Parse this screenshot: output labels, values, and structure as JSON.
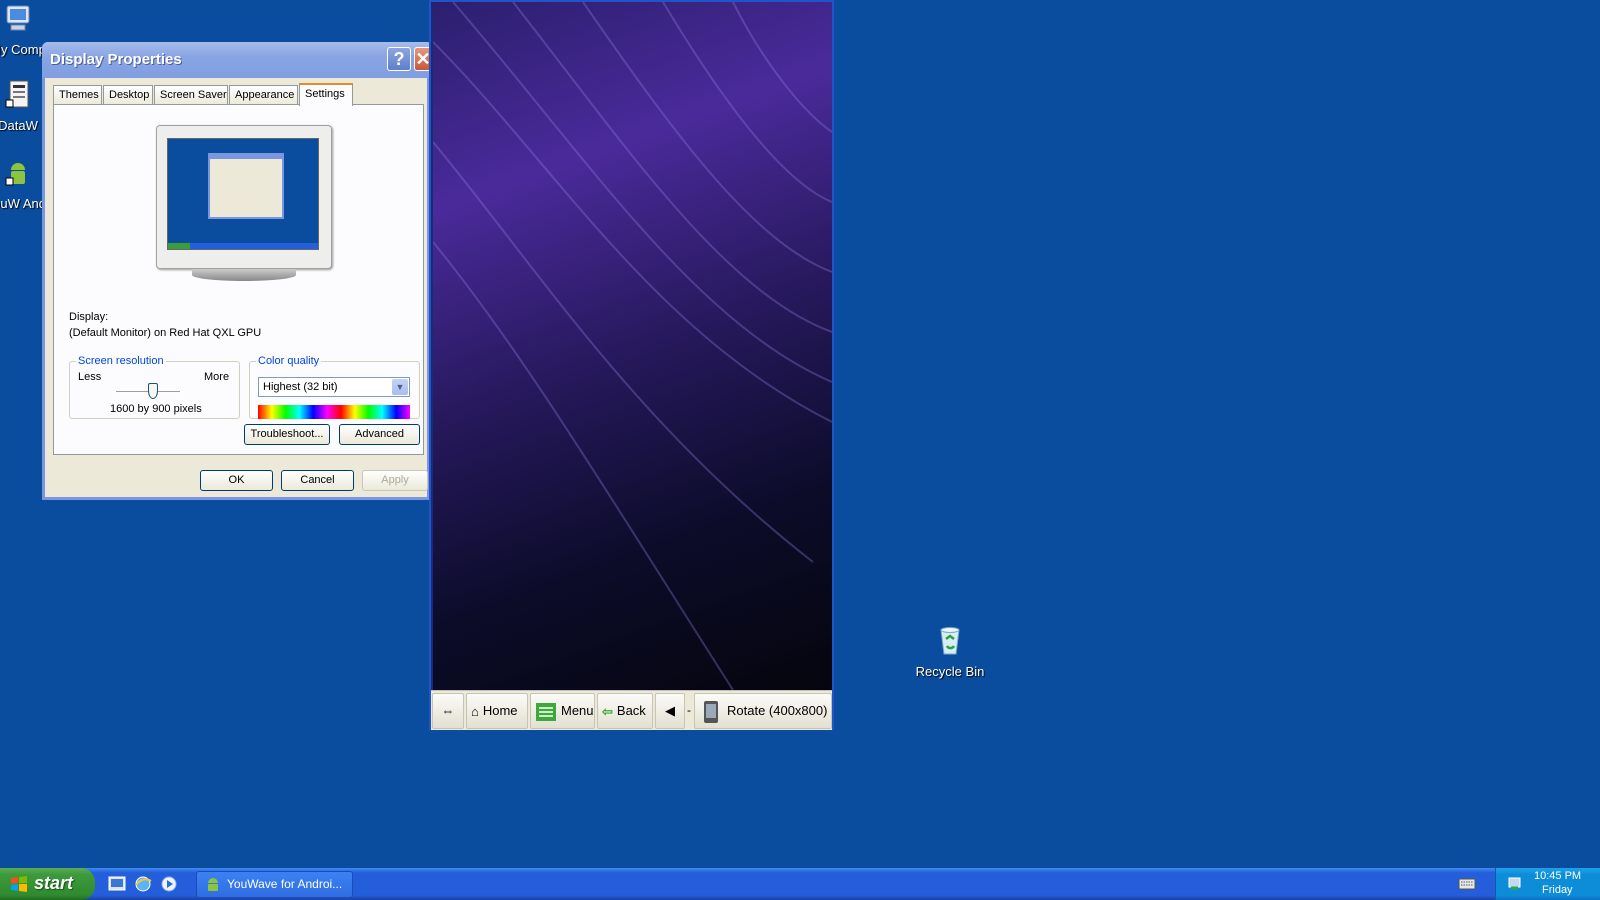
{
  "desktop": {
    "icons": [
      {
        "label": "My Comp",
        "icon": "my-computer-icon"
      },
      {
        "label": "DataW",
        "icon": "datawave-icon"
      },
      {
        "label": "YouW Andr",
        "icon": "youwave-android-icon"
      },
      {
        "label": "Recycle Bin",
        "icon": "recycle-bin-icon"
      }
    ]
  },
  "display_properties": {
    "title": "Display Properties",
    "tabs": [
      "Themes",
      "Desktop",
      "Screen Saver",
      "Appearance",
      "Settings"
    ],
    "active_tab": "Settings",
    "display_label": "Display:",
    "display_value": "(Default Monitor) on Red Hat QXL GPU",
    "resolution": {
      "legend": "Screen resolution",
      "less": "Less",
      "more": "More",
      "value_text": "1600 by 900 pixels",
      "slider_level": 0.55
    },
    "color_quality": {
      "legend": "Color quality",
      "selected": "Highest (32 bit)"
    },
    "buttons": {
      "troubleshoot": "Troubleshoot...",
      "advanced": "Advanced",
      "ok": "OK",
      "cancel": "Cancel",
      "apply": "Apply"
    }
  },
  "emulator": {
    "toolbar": {
      "home": "Home",
      "menu": "Menu",
      "back": "Back",
      "dash": "-",
      "rotate": "Rotate (400x800)"
    }
  },
  "taskbar": {
    "start_label": "start",
    "task_label": "YouWave for Androi...",
    "clock_time": "10:45 PM",
    "clock_day": "Friday"
  },
  "colors": {
    "desktop_bg": "#0a4d9f",
    "taskbar": "#245edb",
    "start_green": "#3c9b3c",
    "legend_blue": "#0046d5"
  }
}
